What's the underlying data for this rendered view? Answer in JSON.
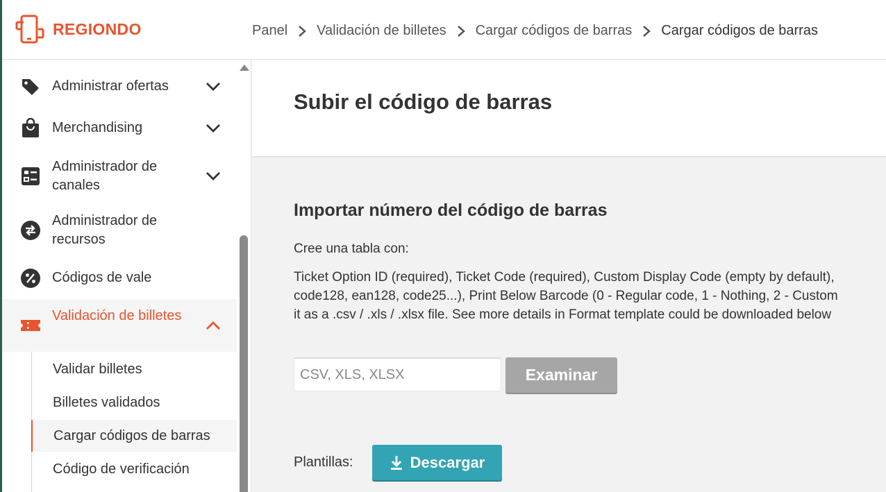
{
  "header": {
    "brand": "REGIONDO",
    "breadcrumb": [
      {
        "label": "Panel"
      },
      {
        "label": "Validación de billetes"
      },
      {
        "label": "Cargar códigos de barras"
      },
      {
        "label": "Cargar códigos de barras"
      }
    ]
  },
  "sidebar": {
    "items": [
      {
        "label": "Administrar ofertas",
        "icon": "tag-icon"
      },
      {
        "label": "Merchandising",
        "icon": "shopping-bag-icon"
      },
      {
        "label": "Administrador de canales",
        "icon": "channel-list-icon"
      },
      {
        "label": "Administrador de recursos",
        "icon": "swap-arrows-icon"
      },
      {
        "label": "Códigos de vale",
        "icon": "percent-icon"
      },
      {
        "label": "Validación de billetes",
        "icon": "ticket-icon"
      }
    ],
    "subitems": [
      {
        "label": "Validar billetes"
      },
      {
        "label": "Billetes validados"
      },
      {
        "label": "Cargar códigos de barras"
      },
      {
        "label": "Código de verificación"
      }
    ]
  },
  "main": {
    "title": "Subir el código de barras",
    "section_title": "Importar número del código de barras",
    "intro": "Cree una tabla con:",
    "description": [
      "Ticket Option ID (required), Ticket Code (required), Custom Display Code (empty by default),",
      "code128, ean128, code25...), Print Below Barcode (0 - Regular code, 1 - Nothing, 2 - Custom",
      "it as a .csv / .xls / .xlsx file. See more details in Format template could be downloaded below"
    ],
    "file_input_placeholder": "CSV, XLS, XLSX",
    "browse_label": "Examinar",
    "templates_label": "Plantillas:",
    "download_label": "Descargar"
  },
  "colors": {
    "brand": "#e8542d",
    "download_button": "#32a4b4",
    "browse_button": "#a6a6a6"
  }
}
